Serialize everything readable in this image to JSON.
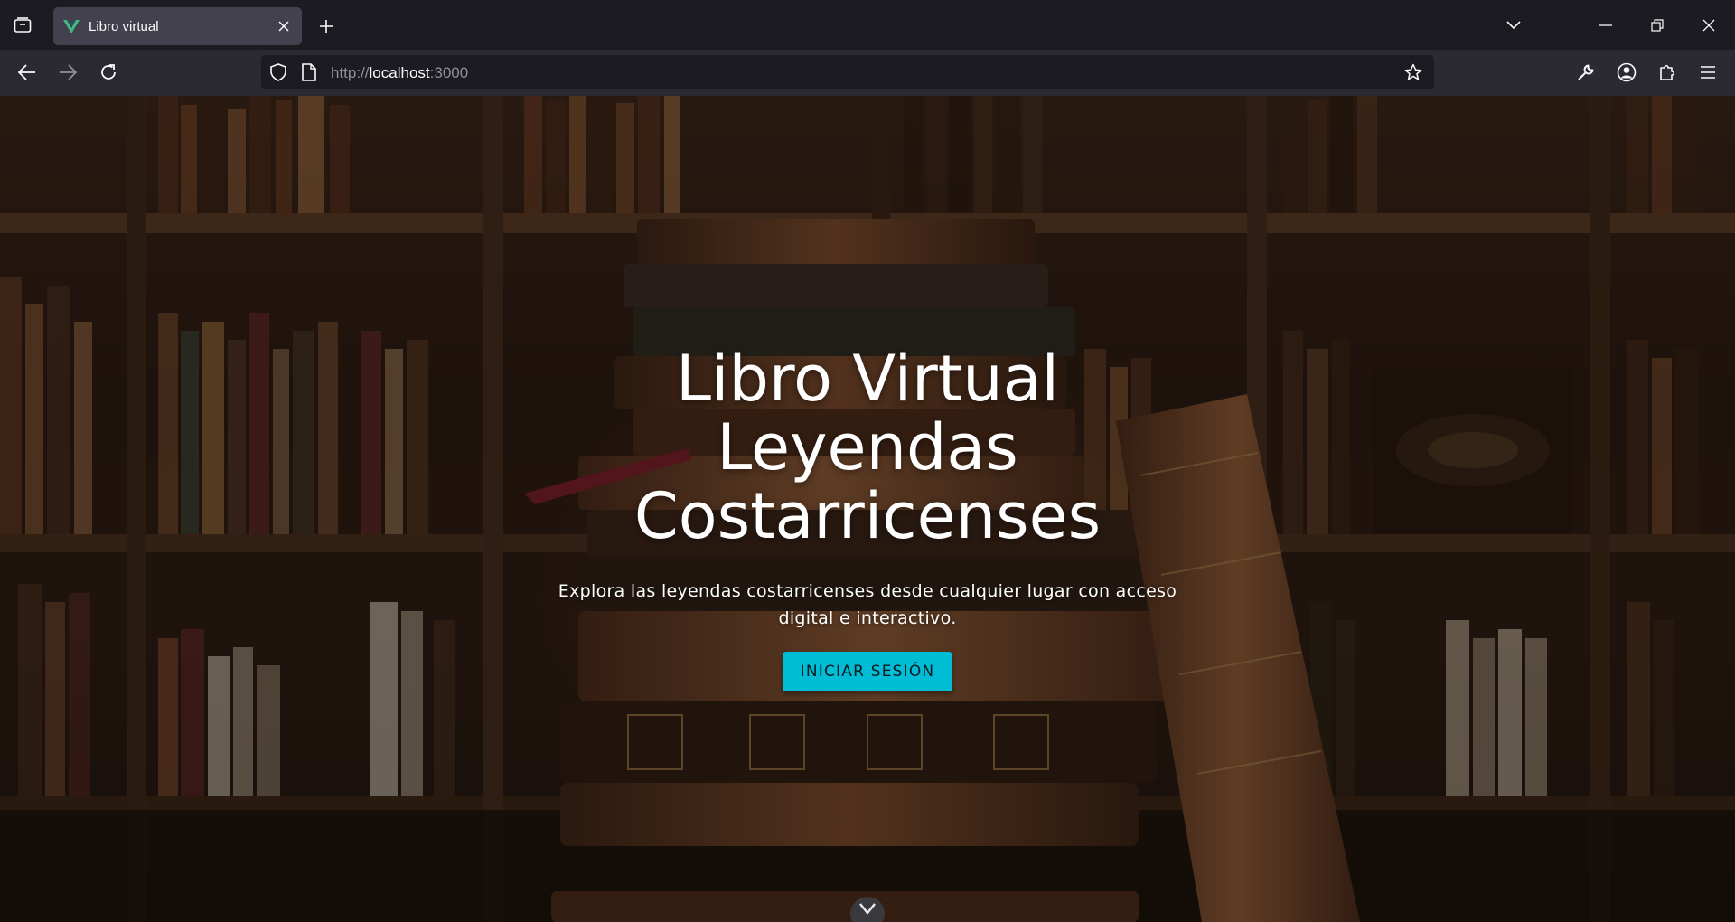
{
  "browser": {
    "tab": {
      "title": "Libro virtual",
      "favicon": "vue-logo-icon"
    },
    "url": {
      "scheme": "http://",
      "host": "localhost",
      "port": ":3000"
    },
    "colors": {
      "tabbar": "#1c1b22",
      "navbar": "#2b2a33",
      "tab_active": "#42414d"
    }
  },
  "hero": {
    "title_line1": "Libro Virtual",
    "title_line2": "Leyendas",
    "title_line3": "Costarricenses",
    "subtitle": "Explora las leyendas costarricenses desde cualquier lugar con acceso digital e interactivo.",
    "login_button": "INICIAR SESIÓN",
    "accent_color": "#00bcd4"
  },
  "background": {
    "image_subject": "stack of antique leather books in front of library bookshelves"
  }
}
